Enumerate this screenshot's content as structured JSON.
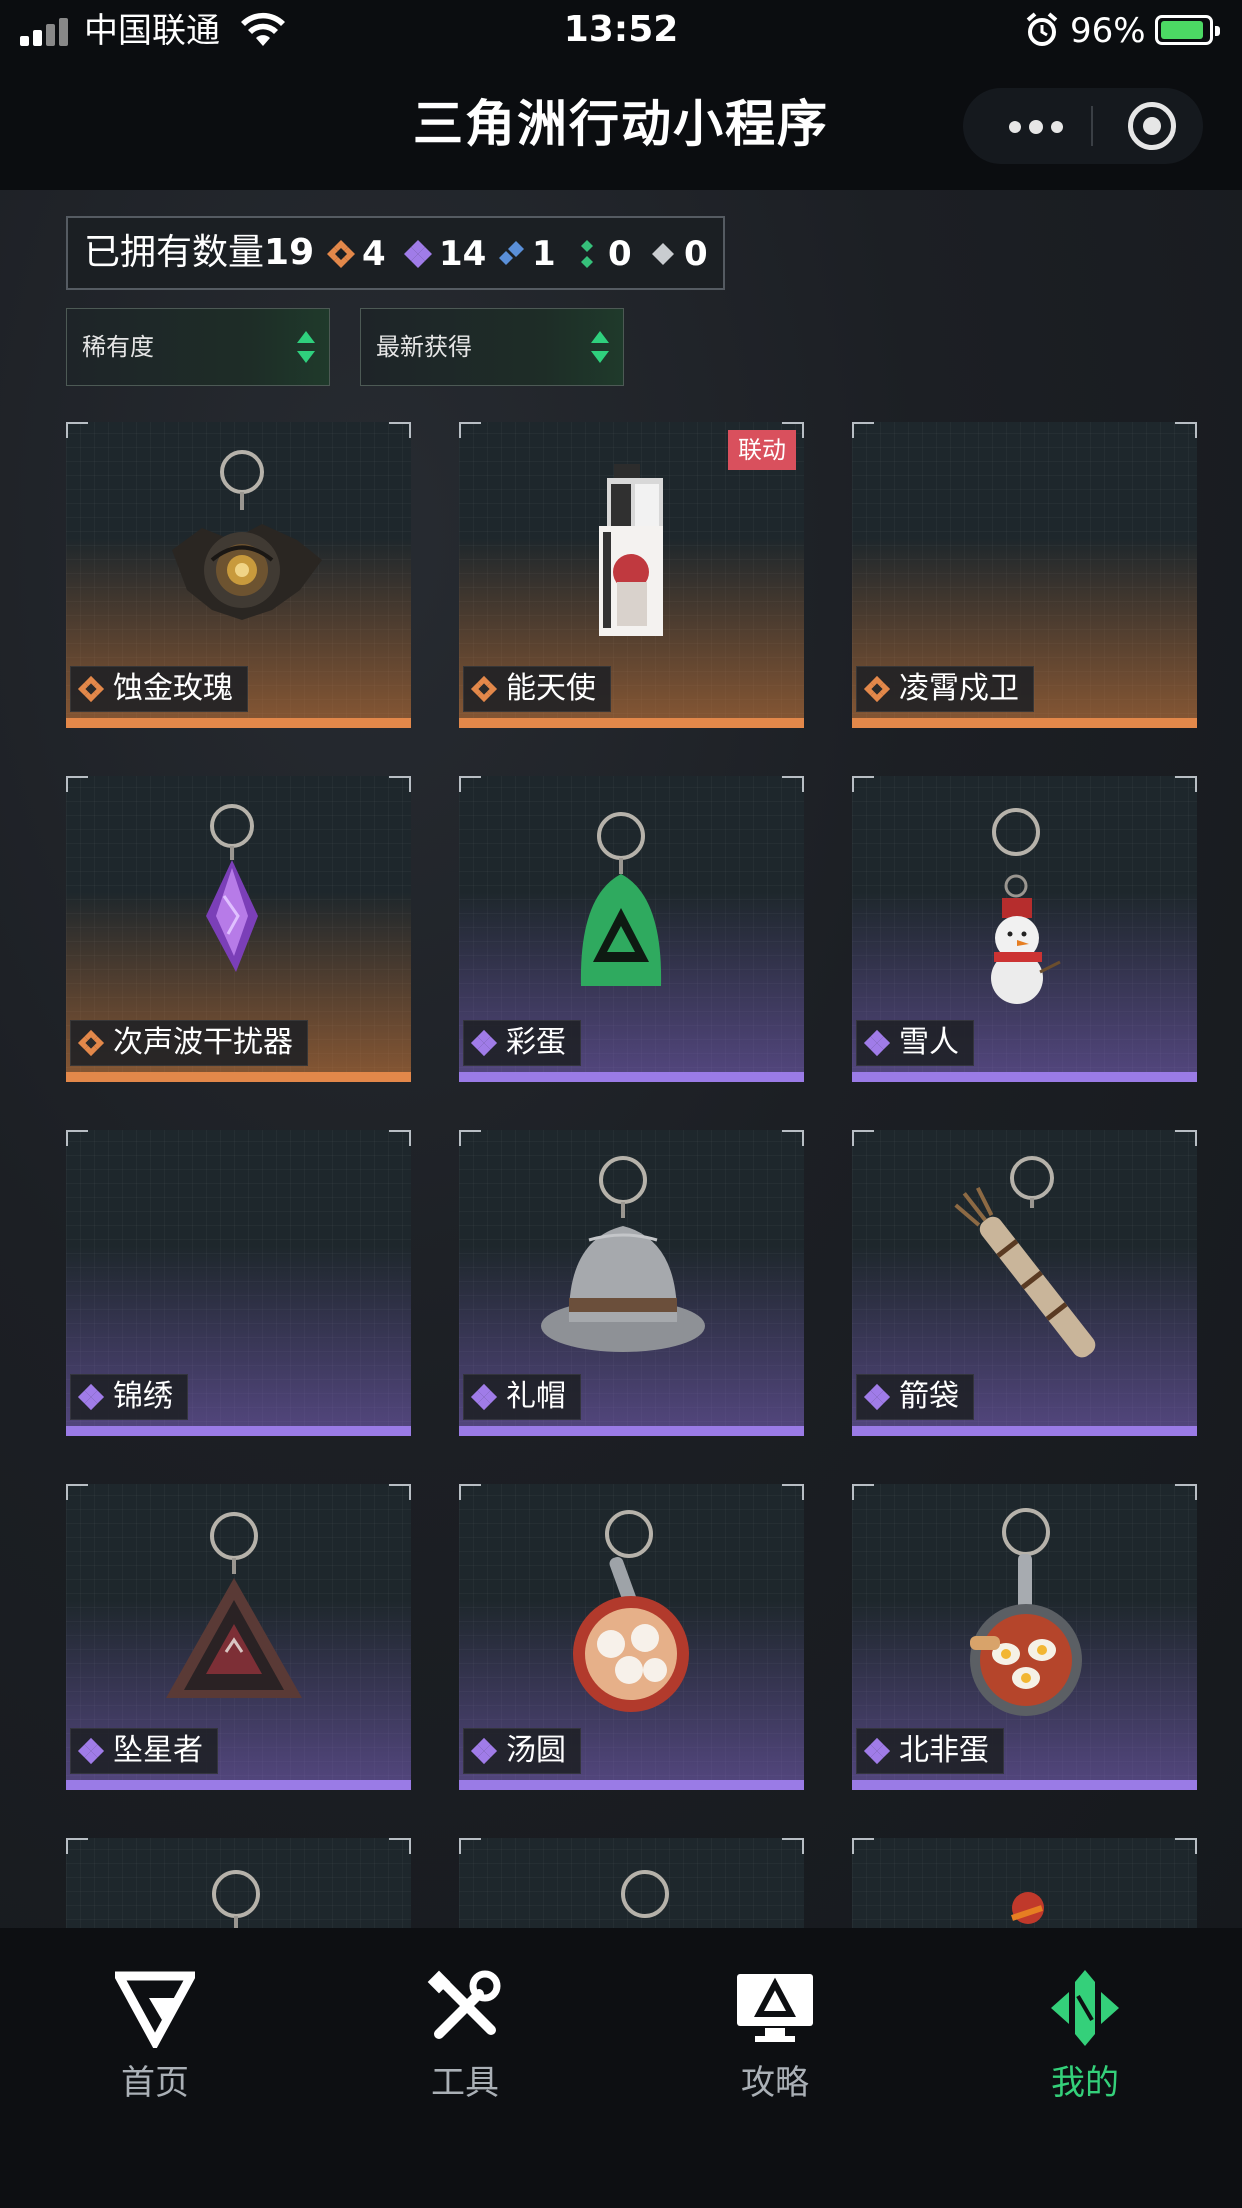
{
  "status_bar": {
    "carrier": "中国联通",
    "time": "13:52",
    "battery": "96%"
  },
  "header": {
    "title": "三角洲行动小程序",
    "more_icon": "more-dots-icon",
    "close_icon": "target-circle-icon"
  },
  "summary": {
    "label": "已拥有数量",
    "total": "19",
    "rarities": [
      {
        "color": "#e3884a",
        "count": "4"
      },
      {
        "color": "#a07ce8",
        "count": "14"
      },
      {
        "color": "#5a8fd8",
        "count": "1"
      },
      {
        "color": "#36c07a",
        "count": "0"
      },
      {
        "color": "#c9ccd0",
        "count": "0"
      }
    ]
  },
  "filters": {
    "rarity": "稀有度",
    "sort": "最新获得"
  },
  "items": [
    {
      "name": "蚀金玫瑰",
      "rarity": "gold",
      "gem_color": "#e3884a"
    },
    {
      "name": "能天使",
      "rarity": "gold",
      "gem_color": "#e3884a",
      "tag": "联动"
    },
    {
      "name": "凌霄戍卫",
      "rarity": "gold",
      "gem_color": "#e3884a"
    },
    {
      "name": "次声波干扰器",
      "rarity": "gold",
      "gem_color": "#e3884a"
    },
    {
      "name": "彩蛋",
      "rarity": "purple",
      "gem_color": "#a07ce8"
    },
    {
      "name": "雪人",
      "rarity": "purple",
      "gem_color": "#a07ce8"
    },
    {
      "name": "锦绣",
      "rarity": "purple",
      "gem_color": "#a07ce8"
    },
    {
      "name": "礼帽",
      "rarity": "purple",
      "gem_color": "#a07ce8"
    },
    {
      "name": "箭袋",
      "rarity": "purple",
      "gem_color": "#a07ce8"
    },
    {
      "name": "坠星者",
      "rarity": "purple",
      "gem_color": "#a07ce8"
    },
    {
      "name": "汤圆",
      "rarity": "purple",
      "gem_color": "#a07ce8"
    },
    {
      "name": "北非蛋",
      "rarity": "purple",
      "gem_color": "#a07ce8"
    }
  ],
  "tabs": [
    {
      "label": "首页",
      "icon": "home-logo-icon"
    },
    {
      "label": "工具",
      "icon": "tools-icon"
    },
    {
      "label": "攻略",
      "icon": "monitor-guide-icon"
    },
    {
      "label": "我的",
      "icon": "profile-logo-icon",
      "active": true,
      "active_color": "#34d07a"
    }
  ]
}
